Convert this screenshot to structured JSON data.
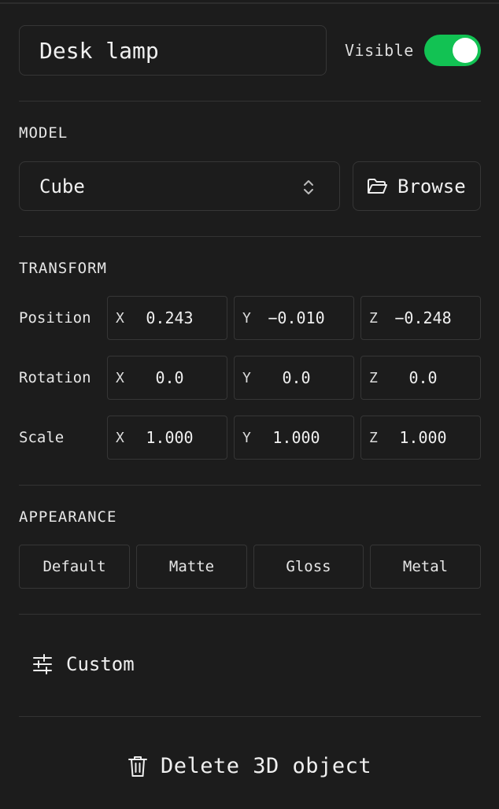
{
  "header": {
    "name_value": "Desk lamp",
    "visible_label": "Visible",
    "visible_on": true,
    "toggle_color": "#12c253"
  },
  "model": {
    "section_title": "MODEL",
    "selected": "Cube",
    "browse_label": "Browse",
    "browse_icon": "folder-open-icon",
    "select_icon": "chevron-up-down-icon"
  },
  "transform": {
    "section_title": "TRANSFORM",
    "rows": [
      {
        "label": "Position",
        "x": "0.243",
        "y": "−0.010",
        "z": "−0.248"
      },
      {
        "label": "Rotation",
        "x": "0.0",
        "y": "0.0",
        "z": "0.0"
      },
      {
        "label": "Scale",
        "x": "1.000",
        "y": "1.000",
        "z": "1.000"
      }
    ],
    "axis_labels": {
      "x": "X",
      "y": "Y",
      "z": "Z"
    }
  },
  "appearance": {
    "section_title": "APPEARANCE",
    "options": [
      "Default",
      "Matte",
      "Gloss",
      "Metal"
    ]
  },
  "custom": {
    "label": "Custom",
    "icon": "sliders-icon"
  },
  "delete": {
    "label": "Delete 3D object",
    "icon": "trash-icon"
  }
}
